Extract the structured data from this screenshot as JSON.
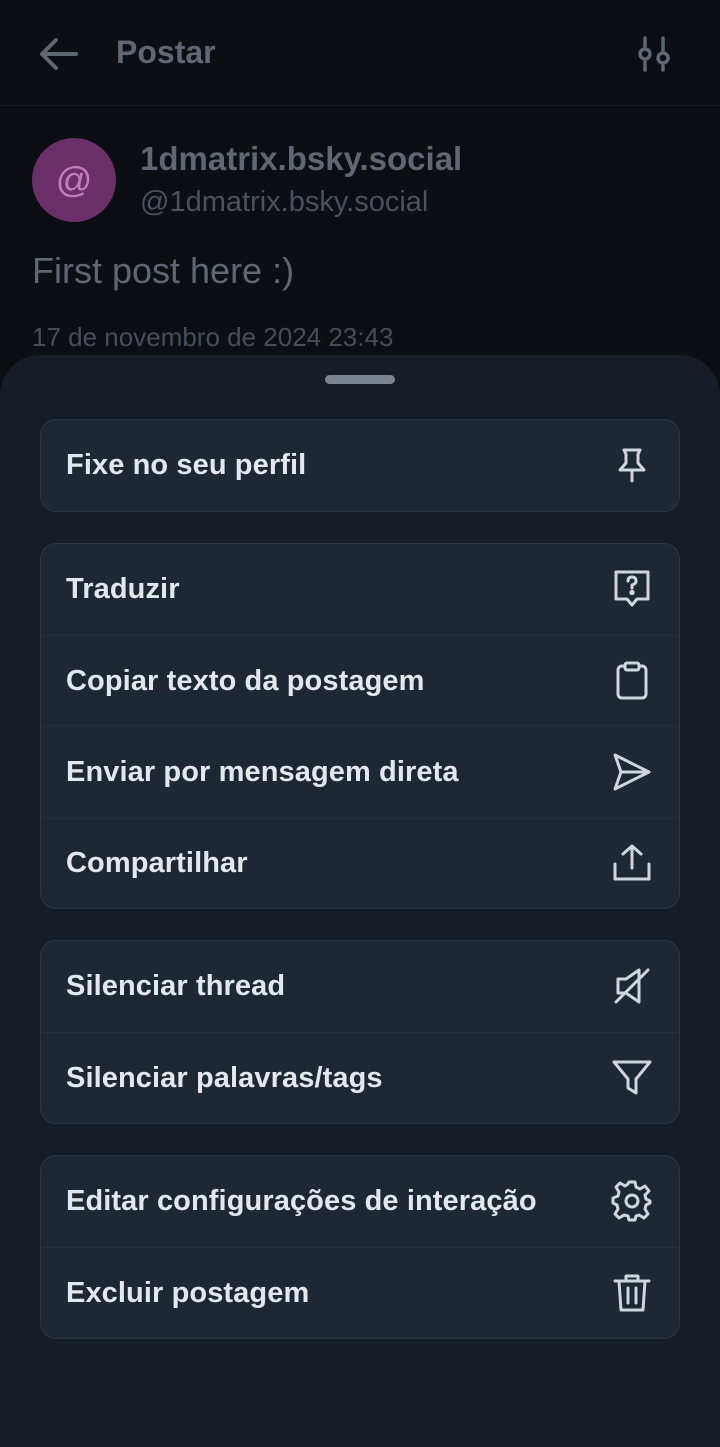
{
  "header": {
    "title": "Postar",
    "back_icon": "arrow-left-icon",
    "filter_icon": "sliders-icon"
  },
  "post": {
    "avatar_symbol": "@",
    "display_name": "1dmatrix.bsky.social",
    "handle": "@1dmatrix.bsky.social",
    "text": "First post here :)",
    "date": "17 de novembro de 2024 23:43"
  },
  "menu": {
    "groups": [
      {
        "items": [
          {
            "label": "Fixe no seu perfil",
            "icon": "pin-icon"
          }
        ]
      },
      {
        "items": [
          {
            "label": "Traduzir",
            "icon": "translate-icon"
          },
          {
            "label": "Copiar texto da postagem",
            "icon": "clipboard-icon"
          },
          {
            "label": "Enviar por mensagem direta",
            "icon": "send-icon"
          },
          {
            "label": "Compartilhar",
            "icon": "share-icon"
          }
        ]
      },
      {
        "items": [
          {
            "label": "Silenciar thread",
            "icon": "mute-icon"
          },
          {
            "label": "Silenciar palavras/tags",
            "icon": "filter-icon"
          }
        ]
      },
      {
        "items": [
          {
            "label": "Editar configurações de interação",
            "icon": "gear-icon"
          },
          {
            "label": "Excluir postagem",
            "icon": "trash-icon"
          }
        ]
      }
    ]
  },
  "colors": {
    "sheet_bg": "#161d26",
    "group_bg": "#1e2833",
    "item_text": "#e3e8ee",
    "avatar_bg": "#6b2f6a"
  }
}
